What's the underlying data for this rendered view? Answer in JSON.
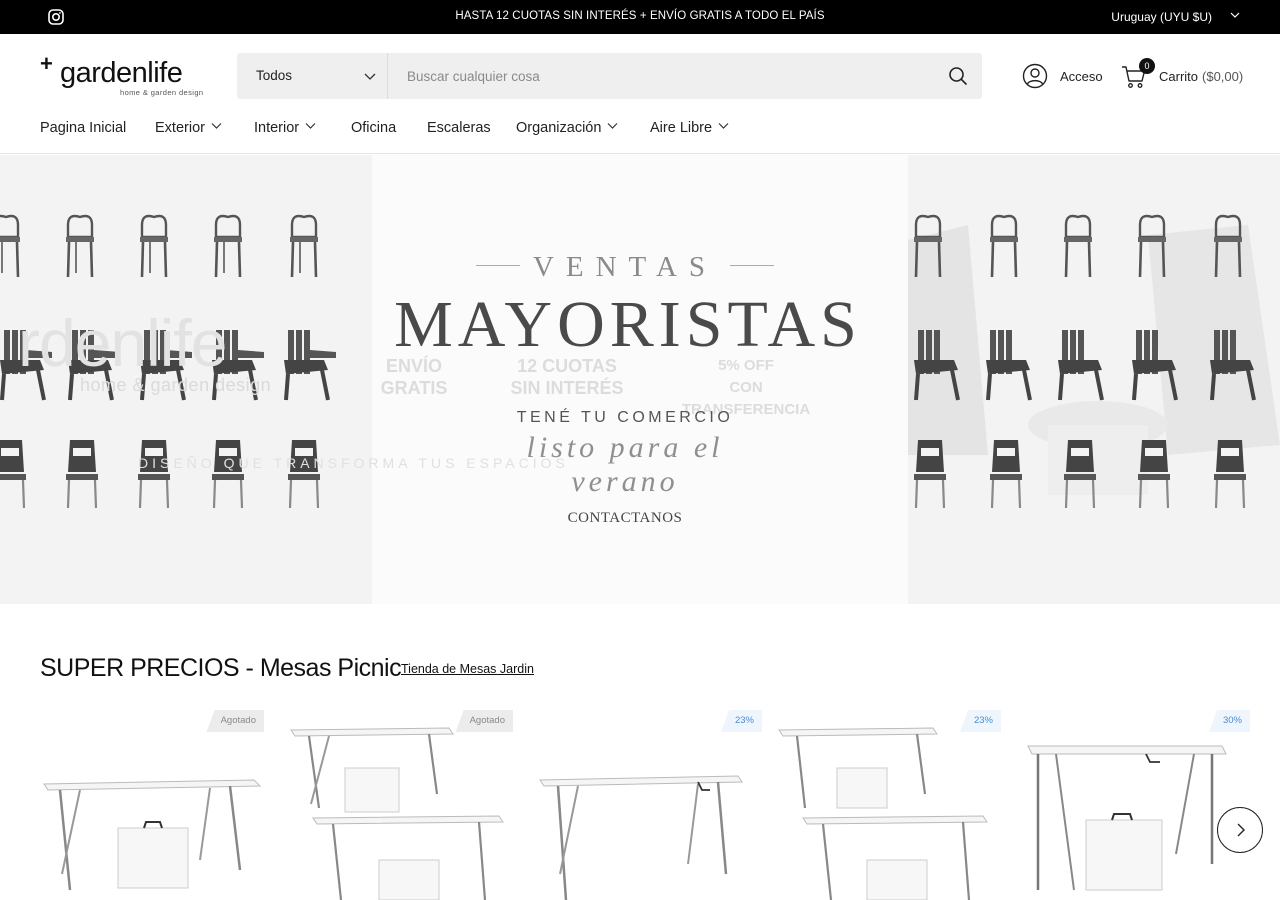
{
  "topbar": {
    "announcement": "HASTA 12 CUOTAS SIN INTERÉS + ENVÍO GRATIS A TODO EL PAÍS",
    "country": "Uruguay (UYU $U)",
    "icons": [
      "instagram-icon",
      "chevron-down-icon"
    ]
  },
  "header": {
    "logo_mark": "+",
    "logo_name": "gardenlife",
    "logo_tagline": "home & garden design",
    "search_category": "Todos",
    "search_placeholder": "Buscar cualquier cosa",
    "account_label": "Acceso",
    "cart_count": "0",
    "cart_label": "Carrito",
    "cart_total": "($0,00)"
  },
  "nav": {
    "items": [
      {
        "label": "Pagina Inicial",
        "dropdown": false
      },
      {
        "label": "Exterior",
        "dropdown": true
      },
      {
        "label": "Interior",
        "dropdown": true
      },
      {
        "label": "Oficina",
        "dropdown": false
      },
      {
        "label": "Escaleras",
        "dropdown": false
      },
      {
        "label": "Organización",
        "dropdown": true
      },
      {
        "label": "Aire Libre",
        "dropdown": true
      }
    ]
  },
  "hero": {
    "eyebrow": "VENTAS",
    "title": "MAYORISTAS",
    "subtitle": "TENÉ TU COMERCIO",
    "script": "listo para el verano",
    "cta": "CONTACTANOS",
    "ghost_brand": "rdenlife",
    "ghost_tagline": "home & garden design",
    "ghost_feature_1": "ENVÍO\nGRATIS",
    "ghost_feature_2": "12 CUOTAS\nSIN INTERÉS",
    "ghost_feature_3": "5% OFF\nCON TRANSFERENCIA",
    "ghost_slogan": "DISEÑO QUE TRANSFORMA TUS ESPACIOS"
  },
  "section": {
    "title": "SUPER PRECIOS - Mesas Picnic",
    "link": "Tienda de Mesas Jardin"
  },
  "products": [
    {
      "badge": "Agotado",
      "badge_type": "sold"
    },
    {
      "badge": "Agotado",
      "badge_type": "sold"
    },
    {
      "badge": "23%",
      "badge_type": "pct"
    },
    {
      "badge": "23%",
      "badge_type": "pct"
    },
    {
      "badge": "30%",
      "badge_type": "pct"
    }
  ],
  "colors": {
    "topbar_bg": "#000000",
    "search_bg": "#efefef",
    "badge_sold_bg": "#ececec",
    "badge_pct_text": "#4a8ed1"
  }
}
